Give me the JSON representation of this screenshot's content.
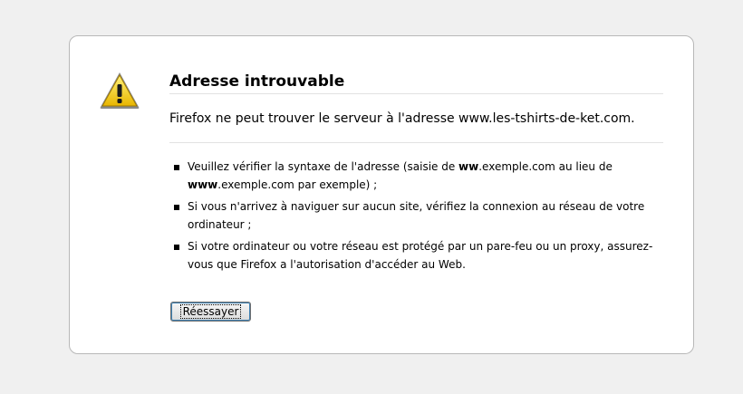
{
  "page": {
    "title": "Adresse introuvable",
    "short_description": "Firefox ne peut trouver le serveur à l'adresse www.les-tshirts-de-ket.com.",
    "icon": "warning-icon"
  },
  "suggestions": [
    {
      "part1": "Veuillez vérifier la syntaxe de l'adresse (saisie de ",
      "bold1": "ww",
      "part2": ".exemple.com au lieu de ",
      "bold2": "www",
      "part3": ".exemple.com par exemple) ;"
    },
    {
      "text": "Si vous n'arrivez à naviguer sur aucun site, vérifiez la connexion au réseau de votre ordinateur ;"
    },
    {
      "text": "Si votre ordinateur ou votre réseau est protégé par un pare-feu ou un proxy, assurez-vous que Firefox a l'autorisation d'accéder au Web."
    }
  ],
  "retry_button": {
    "label": "Réessayer"
  },
  "colors": {
    "background": "#f0f0f0",
    "box": "#ffffff",
    "warning_yellow": "#f5d21c"
  }
}
